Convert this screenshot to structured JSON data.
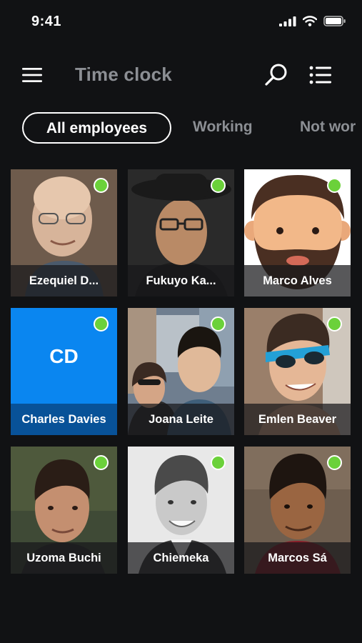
{
  "status_bar": {
    "time": "9:41"
  },
  "header": {
    "title": "Time clock"
  },
  "tabs": [
    {
      "label": "All employees",
      "active": true
    },
    {
      "label": "Working",
      "active": false
    },
    {
      "label": "Not wor",
      "active": false
    }
  ],
  "employees": [
    {
      "name": "Ezequiel D...",
      "working": true,
      "avatar": "photo"
    },
    {
      "name": "Fukuyo Ka...",
      "working": true,
      "avatar": "photo"
    },
    {
      "name": "Marco Alves",
      "working": true,
      "avatar": "illustration"
    },
    {
      "name": "Charles Davies",
      "working": true,
      "avatar": "initials",
      "initials": "CD"
    },
    {
      "name": "Joana Leite",
      "working": true,
      "avatar": "photo"
    },
    {
      "name": "Emlen Beaver",
      "working": true,
      "avatar": "photo"
    },
    {
      "name": "Uzoma Buchi",
      "working": true,
      "avatar": "photo"
    },
    {
      "name": "Chiemeka",
      "working": true,
      "avatar": "photo"
    },
    {
      "name": "Marcos Sá",
      "working": true,
      "avatar": "photo"
    }
  ],
  "colors": {
    "background": "#111214",
    "status_working": "#6bd13a",
    "initials_tile": "#0a86f0",
    "muted_text": "#8c8f94"
  },
  "icons": [
    "menu-icon",
    "search-icon",
    "list-view-icon",
    "signal-icon",
    "wifi-icon",
    "battery-icon"
  ]
}
